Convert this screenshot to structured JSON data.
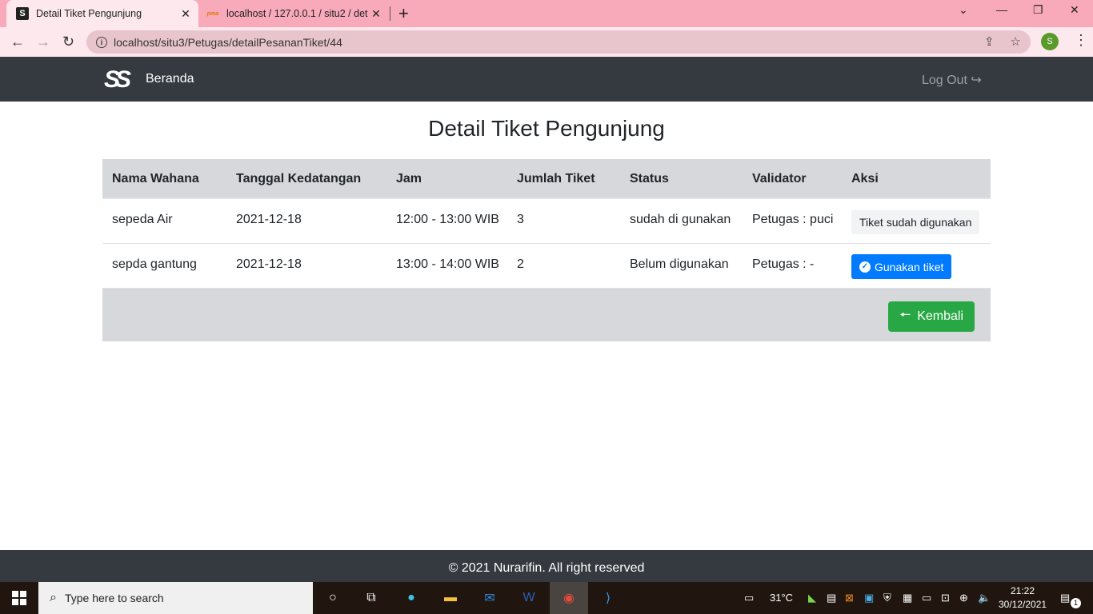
{
  "browser": {
    "tabs": [
      {
        "title": "Detail Tiket Pengunjung",
        "active": true
      },
      {
        "title": "localhost / 127.0.0.1 / situ2 / deta",
        "active": false
      }
    ],
    "url": "localhost/situ3/Petugas/detailPesananTiket/44",
    "profile_initial": "S"
  },
  "nav": {
    "home": "Beranda",
    "logout": "Log Out"
  },
  "page": {
    "title": "Detail Tiket Pengunjung"
  },
  "table": {
    "headers": [
      "Nama Wahana",
      "Tanggal Kedatangan",
      "Jam",
      "Jumlah Tiket",
      "Status",
      "Validator",
      "Aksi"
    ],
    "rows": [
      {
        "wahana": "sepeda Air",
        "tanggal": "2021-12-18",
        "jam": "12:00 - 13:00 WIB",
        "jumlah": "3",
        "status": "sudah di gunakan",
        "validator": "Petugas : puci",
        "aksi": "Tiket sudah digunakan"
      },
      {
        "wahana": "sepda gantung",
        "tanggal": "2021-12-18",
        "jam": "13:00 - 14:00 WIB",
        "jumlah": "2",
        "status": "Belum digunakan",
        "validator": "Petugas : -",
        "aksi": "Gunakan tiket"
      }
    ],
    "back_label": "Kembali"
  },
  "footer": {
    "text": "© 2021 Nurarifin. All right reserved"
  },
  "taskbar": {
    "search_placeholder": "Type here to search",
    "temperature": "31°C",
    "time": "21:22",
    "date": "30/12/2021",
    "notification_count": "1"
  },
  "colors": {
    "tabbar": "#f8a9ba",
    "navbar": "#343a40",
    "primary": "#007bff",
    "success": "#28a745"
  }
}
